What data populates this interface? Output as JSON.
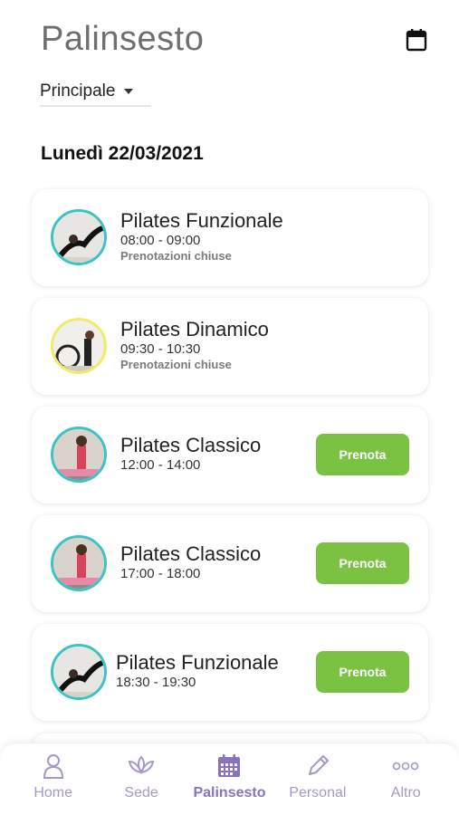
{
  "header": {
    "title": "Palinsesto"
  },
  "filter": {
    "selected": "Principale"
  },
  "date_heading": "Lunedì 22/03/2021",
  "classes": [
    {
      "title": "Pilates Funzionale",
      "time": "08:00 - 09:00",
      "status": "Prenotazioni chiuse"
    },
    {
      "title": "Pilates Dinamico",
      "time": "09:30 - 10:30",
      "status": "Prenotazioni chiuse"
    },
    {
      "title": "Pilates Classico",
      "time": "12:00 - 14:00",
      "button": "Prenota"
    },
    {
      "title": "Pilates Classico",
      "time": "17:00 - 18:00",
      "button": "Prenota"
    },
    {
      "title": "Pilates Funzionale",
      "time": "18:30 - 19:30",
      "button": "Prenota"
    }
  ],
  "nav": {
    "home": "Home",
    "sede": "Sede",
    "palinsesto": "Palinsesto",
    "personal": "Personal",
    "altro": "Altro"
  },
  "colors": {
    "accent_green": "#7cc242",
    "nav_purple": "#a797c9",
    "avatar_ring_teal": "#3cc3c4",
    "avatar_ring_yellow": "#f0ec63"
  }
}
